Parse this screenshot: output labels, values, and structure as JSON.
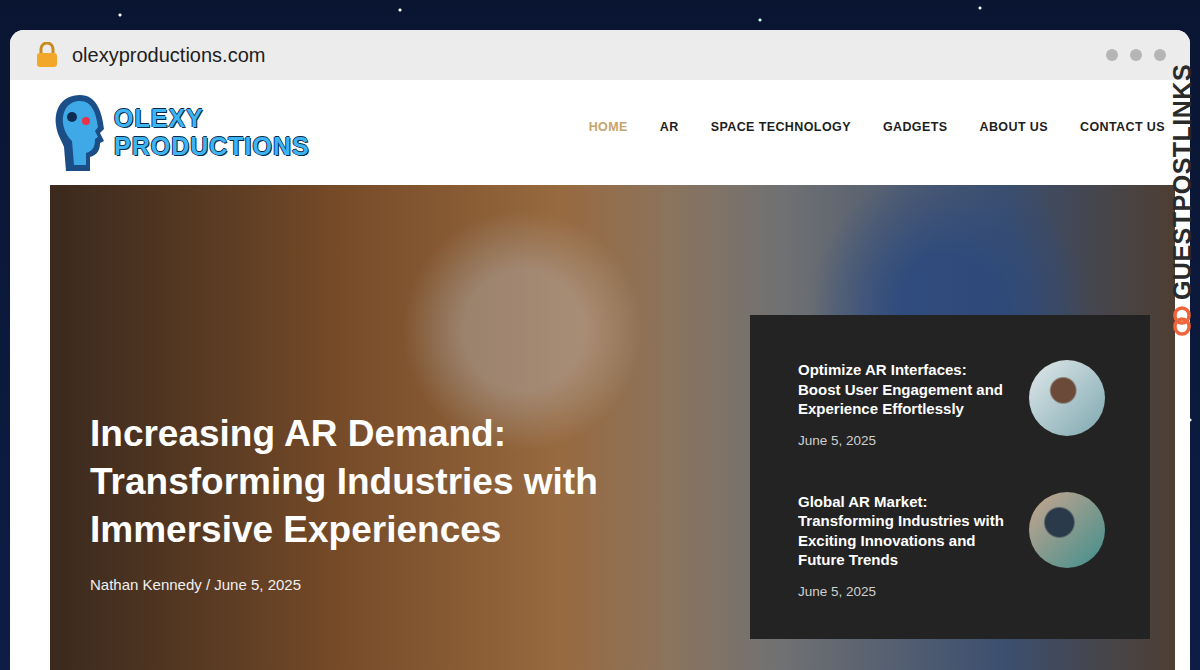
{
  "browser": {
    "url": "olexyproductions.com"
  },
  "logo": {
    "line1": "OLEXY",
    "line2": "PRODUCTIONS"
  },
  "nav": [
    {
      "label": "HOME",
      "selected": true
    },
    {
      "label": "AR",
      "selected": false
    },
    {
      "label": "SPACE TECHNOLOGY",
      "selected": false
    },
    {
      "label": "GADGETS",
      "selected": false
    },
    {
      "label": "ABOUT US",
      "selected": false
    },
    {
      "label": "CONTACT US",
      "selected": false
    }
  ],
  "hero": {
    "title": "Increasing AR Demand: Transforming Industries with Immersive Experiences",
    "byline": "Nathan Kennedy / June 5, 2025"
  },
  "side_posts": [
    {
      "title": "Optimize AR Interfaces: Boost User Engagement and Experience Effortlessly",
      "date": "June 5, 2025"
    },
    {
      "title": "Global AR Market: Transforming Industries with Exciting Innovations and Future Trends",
      "date": "June 5, 2025"
    }
  ],
  "watermark": {
    "text": "GUESTPOSTLINKS"
  }
}
